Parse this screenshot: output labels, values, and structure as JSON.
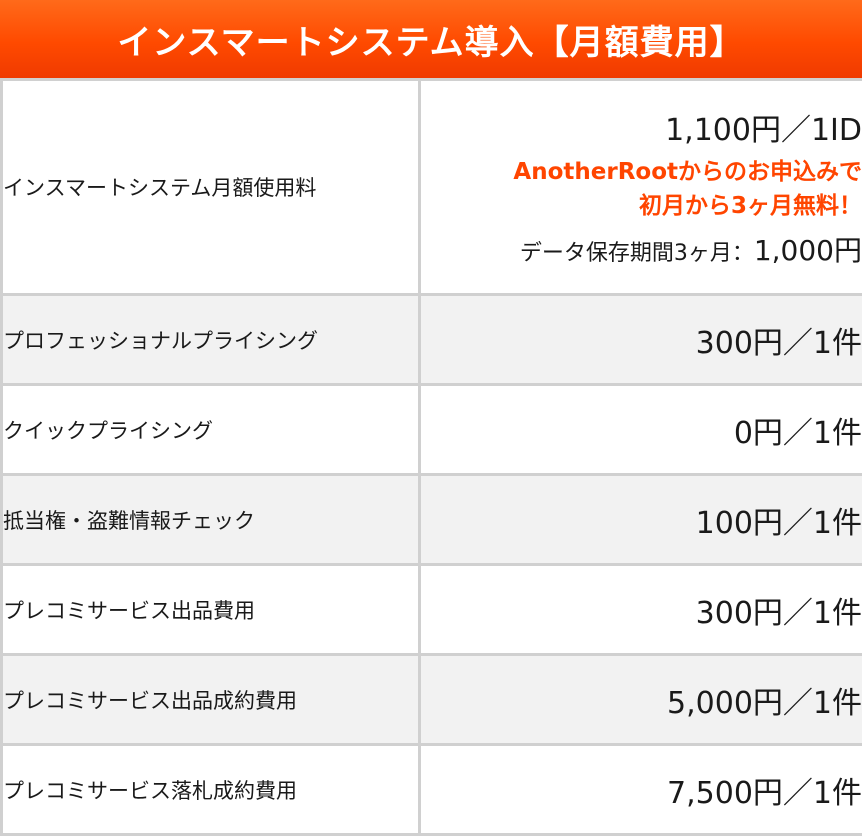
{
  "title": "インスマートシステム導入【月額費用】",
  "rows": [
    {
      "label": "インスマートシステム月額使用料",
      "price": "1,100円／1ID",
      "promo_line1": "AnotherRootからのお申込みで",
      "promo_line2": "初月から3ヶ月無料！",
      "storage_label": "データ保存期間3ヶ月：",
      "storage_price": "1,000円"
    },
    {
      "label": "プロフェッショナルプライシング",
      "price": "300円／1件"
    },
    {
      "label": "クイックプライシング",
      "price": "0円／1件"
    },
    {
      "label": "抵当権・盗難情報チェック",
      "price": "100円／1件"
    },
    {
      "label": "プレコミサービス出品費用",
      "price": "300円／1件"
    },
    {
      "label": "プレコミサービス出品成約費用",
      "price": "5,000円／1件"
    },
    {
      "label": "プレコミサービス落札成約費用",
      "price": "7,500円／1件"
    }
  ],
  "colors": {
    "header_bg": "#ff4a00",
    "promo_text": "#ff4500",
    "alt_row_bg": "#f2f2f2",
    "border": "#d0d0d0"
  }
}
